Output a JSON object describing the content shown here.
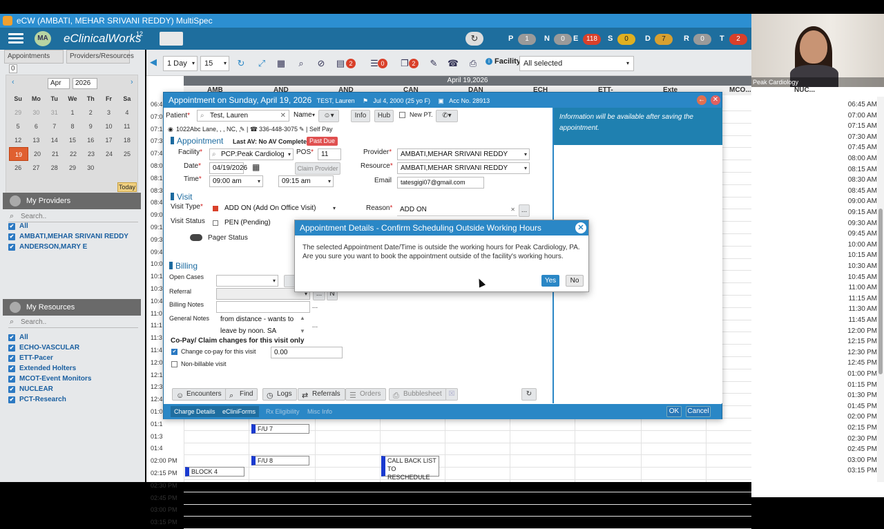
{
  "app": {
    "title": "eCW (AMBATI, MEHAR SRIVANI REDDY) MultiSpec",
    "brand": "eClinicalWorks",
    "version": "12",
    "user_initials": "MA"
  },
  "jellybeans": [
    {
      "letter": "P",
      "count": "1",
      "color": "#9a9a9a"
    },
    {
      "letter": "N",
      "count": "0",
      "color": "#9a9a9a"
    },
    {
      "letter": "E",
      "count": "118",
      "color": "#d9402a"
    },
    {
      "letter": "S",
      "count": "0",
      "color": "#e0b020"
    },
    {
      "letter": "D",
      "count": "7",
      "color": "#d8a030"
    },
    {
      "letter": "R",
      "count": "0",
      "color": "#9a9a9a"
    },
    {
      "letter": "T",
      "count": "2",
      "color": "#d9402a"
    }
  ],
  "video": {
    "name": "Peak Cardiology"
  },
  "left": {
    "tab_appointments": "Appointments",
    "tab_appointments_count": "0",
    "tab_providers": "Providers/Resources",
    "cal_month": "Apr",
    "cal_year": "2026",
    "dow": [
      "Su",
      "Mo",
      "Tu",
      "We",
      "Th",
      "Fr",
      "Sa"
    ],
    "weeks": [
      [
        "29",
        "30",
        "31",
        "1",
        "2",
        "3",
        "4"
      ],
      [
        "5",
        "6",
        "7",
        "8",
        "9",
        "10",
        "11"
      ],
      [
        "12",
        "13",
        "14",
        "15",
        "16",
        "17",
        "18"
      ],
      [
        "19",
        "20",
        "21",
        "22",
        "23",
        "24",
        "25"
      ],
      [
        "26",
        "27",
        "28",
        "29",
        "30",
        "",
        ""
      ]
    ],
    "today_label": "Today",
    "my_providers": "My Providers",
    "search_placeholder": "Search..",
    "providers": [
      "All",
      "AMBATI,MEHAR SRIVANI REDDY",
      "ANDERSON,MARY E"
    ],
    "my_resources": "My Resources",
    "resources": [
      "All",
      "ECHO-VASCULAR",
      "ETT-Pacer",
      "Extended Holters",
      "MCOT-Event Monitors",
      "NUCLEAR",
      "PCT-Research"
    ]
  },
  "schedbar": {
    "view": "1 Day",
    "interval": "15",
    "badges": [
      "2",
      "0",
      "2"
    ],
    "facility_label": "Facility",
    "facility_value": "All selected"
  },
  "schedule": {
    "date_band": "April 19,2026",
    "columns": [
      "AMB",
      "AND",
      "AND",
      "CAN",
      "DAN",
      "ECH",
      "ETT-",
      "Exte",
      "MCO...",
      "NUC..."
    ],
    "times": [
      "06:4",
      "07:0",
      "07:1",
      "07:3",
      "07:4",
      "08:0",
      "08:1",
      "08:3",
      "08:4",
      "09:0",
      "09:1",
      "09:3",
      "09:4",
      "10:0",
      "10:1",
      "10:3",
      "10:4",
      "11:0",
      "11:1",
      "11:3",
      "11:4",
      "12:0",
      "12:1",
      "12:3",
      "12:4",
      "01:0",
      "01:1",
      "01:3",
      "01:4",
      "02:00 PM",
      "02:15 PM",
      "02:30 PM",
      "02:45 PM",
      "03:00 PM",
      "03:15 PM"
    ],
    "right_times": [
      "06:45 AM",
      "07:00 AM",
      "07:15 AM",
      "07:30 AM",
      "07:45 AM",
      "08:00 AM",
      "08:15 AM",
      "08:30 AM",
      "08:45 AM",
      "09:00 AM",
      "09:15 AM",
      "09:30 AM",
      "09:45 AM",
      "10:00 AM",
      "10:15 AM",
      "10:30 AM",
      "10:45 AM",
      "11:00 AM",
      "11:15 AM",
      "11:30 AM",
      "11:45 AM",
      "12:00 PM",
      "12:15 PM",
      "12:30 PM",
      "12:45 PM",
      "01:00 PM",
      "01:15 PM",
      "01:30 PM",
      "01:45 PM",
      "02:00 PM",
      "02:15 PM",
      "02:30 PM",
      "02:45 PM",
      "03:00 PM",
      "03:15 PM"
    ],
    "appts": [
      {
        "label": "F/U 7"
      },
      {
        "label": "F/U 8"
      },
      {
        "label": "BLOCK 4"
      },
      {
        "label": "CALL BACK LIST TO RESCHEDULE"
      }
    ]
  },
  "appt": {
    "title": "Appointment on Sunday, April 19, 2026",
    "patient_short": "TEST, Lauren",
    "dob": "Jul 4, 2000 (25 yo F)",
    "acc": "Acc No. 28913",
    "patient_label": "Patient",
    "patient_value": "Test, Lauren",
    "name_btn": "Name",
    "info_btn": "Info",
    "hub_btn": "Hub",
    "new_pt": "New PT.",
    "address": "1022Abc Lane, , , NC, ,",
    "phone": "336-448-3075",
    "pay": "Self Pay",
    "sect_appointment": "Appointment",
    "last_av": "Last AV: No AV Completed",
    "past_due": "Past Due",
    "facility_label": "Facility",
    "facility_value": "PCP:Peak Cardiolog",
    "pos_label": "POS",
    "pos_value": "11",
    "provider_label": "Provider",
    "provider_value": "AMBATI,MEHAR SRIVANI REDDY",
    "date_label": "Date",
    "date_value": "04/19/2026",
    "claim_provider": "Claim Provider",
    "resource_label": "Resource",
    "resource_value": "AMBATI,MEHAR SRIVANI REDDY",
    "time_label": "Time",
    "time_start": "09:00 am",
    "time_end": "09:15 am",
    "email_label": "Email",
    "email_value": "tatesgigi07@gmail.com",
    "sect_visit": "Visit",
    "visit_type_label": "Visit Type",
    "visit_type_value": "ADD ON (Add On Office Visit)",
    "reason_label": "Reason",
    "reason_value": "ADD ON",
    "visit_status_label": "Visit Status",
    "visit_status_value": "PEN (Pending)",
    "pager": "Pager Status",
    "sect_billing": "Billing",
    "open_cases": "Open Cases",
    "referral": "Referral",
    "billing_notes": "Billing Notes",
    "general_notes": "General Notes",
    "general_notes_value": "from distance - wants to leave by noon. SA",
    "copay_heading": "Co-Pay/ Claim changes for this visit only",
    "change_copay": "Change co-pay for this visit",
    "copay_value": "0.00",
    "non_billable": "Non-billable visit",
    "info_msg": "Information will be available after saving the appointment.",
    "footer_buttons": [
      "Encounters",
      "Find",
      "Logs",
      "Referrals",
      "Orders",
      "Bubblesheet"
    ],
    "bottom_tabs": [
      "Charge Details",
      "eCliniForms",
      "Rx Eligibility",
      "Misc Info"
    ],
    "ok": "OK",
    "cancel": "Cancel"
  },
  "dialog": {
    "title": "Appointment Details - Confirm Scheduling Outside Working Hours",
    "message": "The selected Appointment Date/Time is outside the working hours for Peak Cardiology, PA. Are you sure you want to book the appointment outside of the facility's working hours.",
    "yes": "Yes",
    "no": "No"
  }
}
